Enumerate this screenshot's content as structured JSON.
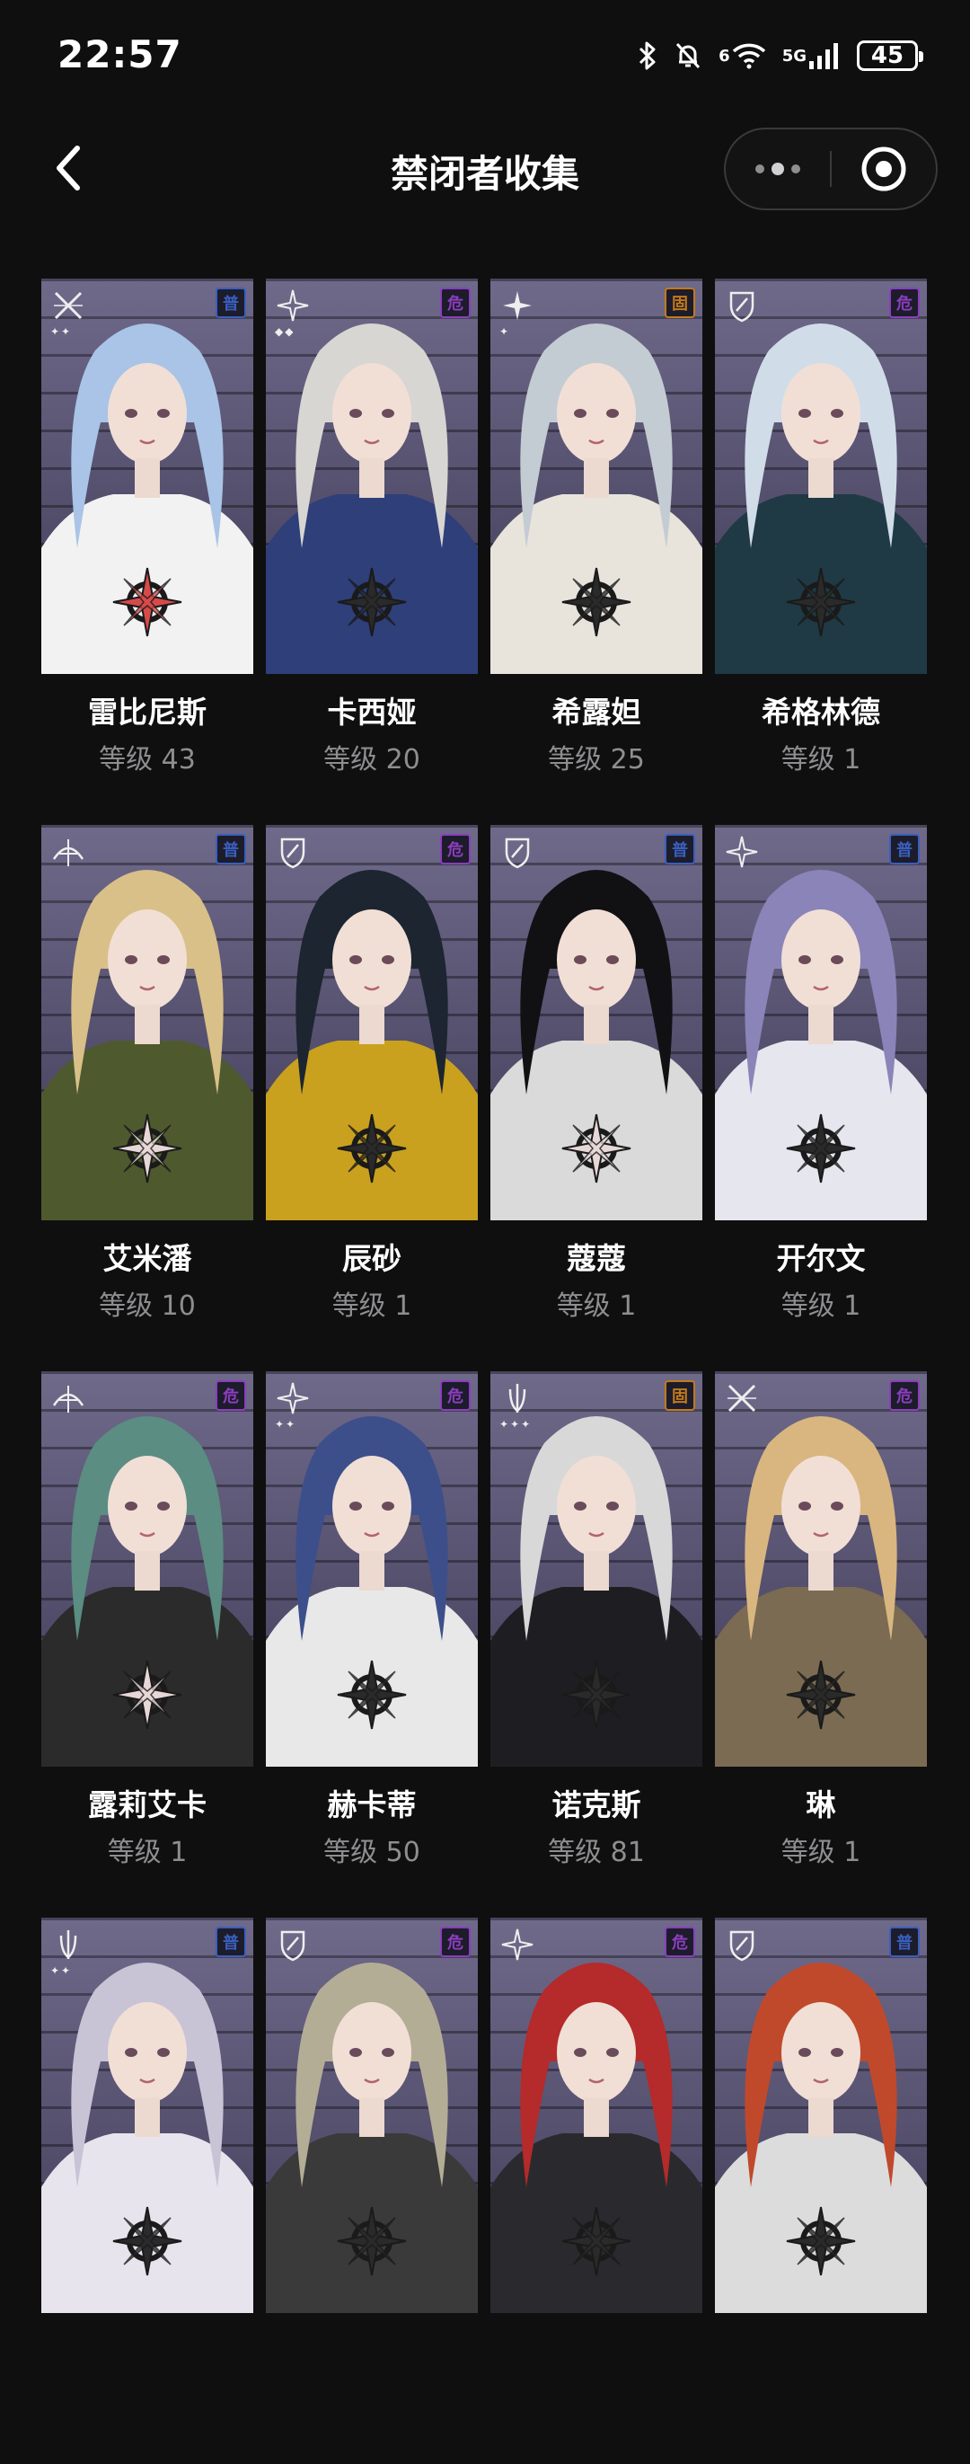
{
  "status_bar": {
    "time": "22:57",
    "network_label": "5G",
    "wifi_label": "6",
    "battery": "45",
    "icons": [
      "bluetooth-icon",
      "mute-bell-icon",
      "wifi-icon",
      "signal-icon",
      "battery-icon"
    ]
  },
  "header": {
    "title": "禁闭者收集",
    "back_icon": "chevron-left-icon",
    "more_icon": "more-dots-icon",
    "close_icon": "record-target-icon"
  },
  "characters": [
    {
      "name": "雷比尼斯",
      "level": "等级 43",
      "badge": "普",
      "badge_color": "#3a5fbf",
      "hair": "#a9c4e6",
      "outfit": "#f2f2f2",
      "emblem": "#d74a4a",
      "rank": "cross-icon",
      "stars": "✦✦"
    },
    {
      "name": "卡西娅",
      "level": "等级 20",
      "badge": "危",
      "badge_color": "#8c3dbf",
      "hair": "#d8d6d2",
      "outfit": "#2e3f7a",
      "emblem": "#2a2a2a",
      "rank": "compass-icon",
      "stars": "◆◆"
    },
    {
      "name": "希露妲",
      "level": "等级 25",
      "badge": "固",
      "badge_color": "#c47a1a",
      "hair": "#c4ccd3",
      "outfit": "#e8e4dc",
      "emblem": "#2a2a2a",
      "rank": "star-icon",
      "stars": "✦"
    },
    {
      "name": "希格林德",
      "level": "等级 1",
      "badge": "危",
      "badge_color": "#8c3dbf",
      "hair": "#d0dde8",
      "outfit": "#1f3a45",
      "emblem": "#2a2a2a",
      "rank": "shield-icon",
      "stars": ""
    },
    {
      "name": "艾米潘",
      "level": "等级 10",
      "badge": "普",
      "badge_color": "#3a5fbf",
      "hair": "#d9c089",
      "outfit": "#4e5a2e",
      "emblem": "#e8d7d7",
      "rank": "crosshair-icon",
      "stars": ""
    },
    {
      "name": "辰砂",
      "level": "等级 1",
      "badge": "危",
      "badge_color": "#8c3dbf",
      "hair": "#1c2530",
      "outfit": "#c9a11e",
      "emblem": "#2a2a2a",
      "rank": "shield-icon",
      "stars": ""
    },
    {
      "name": "蔻蔻",
      "level": "等级 1",
      "badge": "普",
      "badge_color": "#3a5fbf",
      "hair": "#111114",
      "outfit": "#dadada",
      "emblem": "#e8d7d7",
      "rank": "shield-icon",
      "stars": ""
    },
    {
      "name": "开尔文",
      "level": "等级 1",
      "badge": "普",
      "badge_color": "#3a5fbf",
      "hair": "#8a84b8",
      "outfit": "#e6e6ee",
      "emblem": "#2a2a2a",
      "rank": "compass-icon",
      "stars": ""
    },
    {
      "name": "露莉艾卡",
      "level": "等级 1",
      "badge": "危",
      "badge_color": "#8c3dbf",
      "hair": "#5b8d83",
      "outfit": "#2b2b2b",
      "emblem": "#e8d7d7",
      "rank": "crosshair-icon",
      "stars": ""
    },
    {
      "name": "赫卡蒂",
      "level": "等级 50",
      "badge": "危",
      "badge_color": "#8c3dbf",
      "hair": "#3d4f8a",
      "outfit": "#e8e8e8",
      "emblem": "#2a2a2a",
      "rank": "compass-icon",
      "stars": "✦✦"
    },
    {
      "name": "诺克斯",
      "level": "等级 81",
      "badge": "固",
      "badge_color": "#c47a1a",
      "hair": "#d8d8d8",
      "outfit": "#1e1e22",
      "emblem": "#2a2a2a",
      "rank": "bow-icon",
      "stars": "✦✦✦"
    },
    {
      "name": "琳",
      "level": "等级 1",
      "badge": "危",
      "badge_color": "#8c3dbf",
      "hair": "#d9b680",
      "outfit": "#7a6b52",
      "emblem": "#2a2a2a",
      "rank": "cross-icon",
      "stars": ""
    },
    {
      "name": "",
      "level": "",
      "badge": "普",
      "badge_color": "#3a5fbf",
      "hair": "#c9c3d6",
      "outfit": "#e8e4ee",
      "emblem": "#2a2a2a",
      "rank": "bow-icon",
      "stars": "✦✦"
    },
    {
      "name": "",
      "level": "",
      "badge": "危",
      "badge_color": "#8c3dbf",
      "hair": "#b4ad96",
      "outfit": "#3a3a3a",
      "emblem": "#2a2a2a",
      "rank": "shield-icon",
      "stars": ""
    },
    {
      "name": "",
      "level": "",
      "badge": "危",
      "badge_color": "#8c3dbf",
      "hair": "#b52a2a",
      "outfit": "#2a2a2e",
      "emblem": "#2a2a2a",
      "rank": "compass-icon",
      "stars": ""
    },
    {
      "name": "",
      "level": "",
      "badge": "普",
      "badge_color": "#3a5fbf",
      "hair": "#c0492c",
      "outfit": "#dcdcdc",
      "emblem": "#2a2a2a",
      "rank": "shield-icon",
      "stars": ""
    }
  ]
}
